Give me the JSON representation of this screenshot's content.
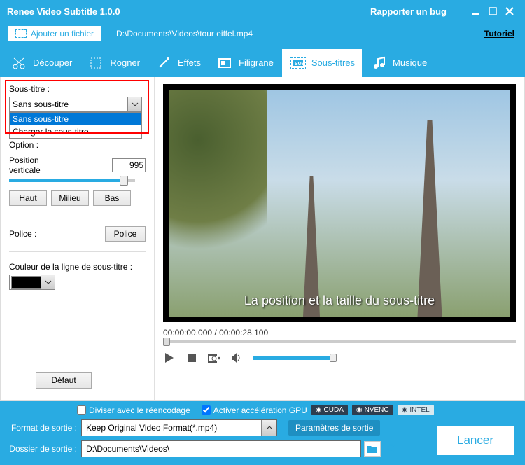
{
  "titlebar": {
    "title": "Renee Video Subtitle 1.0.0",
    "bug": "Rapporter un bug"
  },
  "filebar": {
    "add": "Ajouter un fichier",
    "path": "D:\\Documents\\Videos\\tour eiffel.mp4",
    "tutorial": "Tutoriel"
  },
  "tabs": {
    "cut": "Découper",
    "crop": "Rogner",
    "effects": "Effets",
    "watermark": "Filigrane",
    "subtitles": "Sous-titres",
    "music": "Musique"
  },
  "sidebar": {
    "subtitle_label": "Sous-titre :",
    "subtitle_selected": "Sans sous-titre",
    "options": [
      "Sans sous-titre",
      "Charger le sous-titre"
    ],
    "option_label": "Option :",
    "position_label": "Position verticale",
    "position_value": "995",
    "btn_top": "Haut",
    "btn_middle": "Milieu",
    "btn_bottom": "Bas",
    "font_label": "Police :",
    "btn_font": "Police",
    "color_label": "Couleur de la ligne de sous-titre :",
    "btn_default": "Défaut"
  },
  "preview": {
    "subtitle_text": "La position et la taille du sous-titre",
    "time": "00:00:00.000 / 00:00:28.100"
  },
  "bottom": {
    "split_label": "Diviser avec le réencodage",
    "gpu_label": "Activer accélération GPU",
    "chip_cuda": "CUDA",
    "chip_nvenc": "NVENC",
    "chip_intel": "INTEL",
    "format_label": "Format de sortie :",
    "format_value": "Keep Original Video Format(*.mp4)",
    "params": "Paramètres de sortie",
    "folder_label": "Dossier de sortie :",
    "folder_value": "D:\\Documents\\Videos\\",
    "launch": "Lancer"
  }
}
